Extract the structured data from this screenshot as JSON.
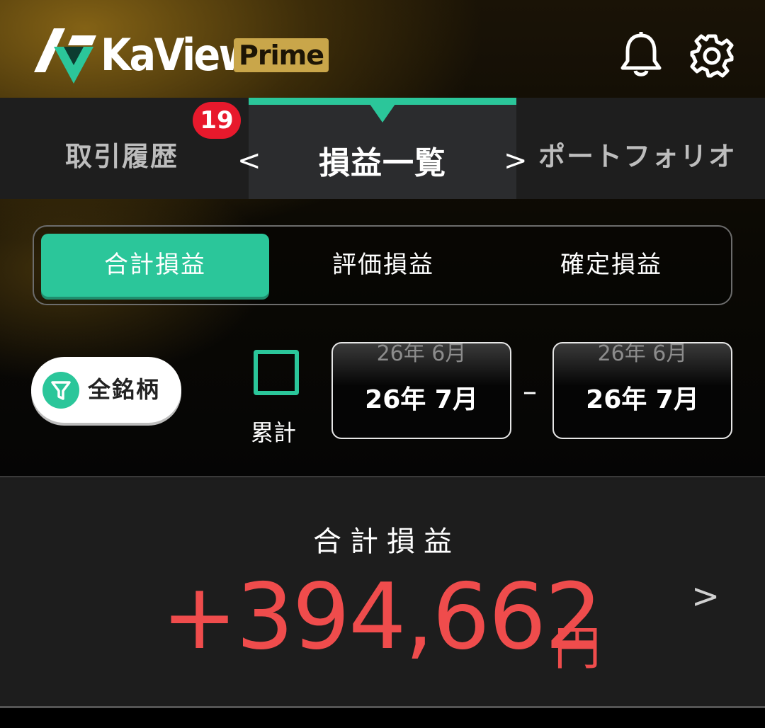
{
  "header": {
    "logo_text": "KaView",
    "badge_text": "Prime",
    "icons": [
      "bell-icon",
      "gear-icon"
    ]
  },
  "tabs": {
    "left": {
      "label": "取引履歴",
      "badge_count": "19"
    },
    "center": {
      "label": "損益一覧",
      "prev_glyph": "<",
      "next_glyph": ">"
    },
    "right": {
      "label": "ポートフォリオ"
    }
  },
  "segment": {
    "items": [
      "合計損益",
      "評価損益",
      "確定損益"
    ],
    "selected_index": 0
  },
  "filter": {
    "button_label": "全銘柄",
    "cumulative_label": "累計",
    "cumulative_checked": false,
    "start": {
      "prev": "26年 6月",
      "current": "26年 7月"
    },
    "dash": "–",
    "end": {
      "prev": "26年 6月",
      "current": "26年 7月"
    }
  },
  "summary": {
    "title": "合計損益",
    "value": "+394,662",
    "unit": "円",
    "chevron": ">"
  },
  "colors": {
    "accent": "#2bc69a",
    "badge": "#e8192c",
    "profit": "#ef4c4c",
    "prime": "#c9a64a"
  }
}
